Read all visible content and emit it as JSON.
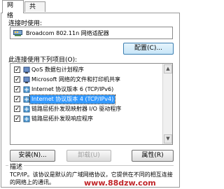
{
  "tabs": [
    {
      "label": "网络",
      "active": true
    },
    {
      "label": "共享",
      "active": false
    }
  ],
  "connect_using_label": "连接时使用:",
  "adapter_name": "Broadcom 802.11n 网络适配器",
  "configure_label": "配置(C)...",
  "items_label": "此连接使用下列项目(O):",
  "items": [
    {
      "label": "QoS 数据包计划程序",
      "checked": true,
      "icon": "service-icon",
      "selected": false
    },
    {
      "label": "Microsoft 网络的文件和打印机共享",
      "checked": true,
      "icon": "service-icon",
      "selected": false
    },
    {
      "label": "Internet 协议版本 6 (TCP/IPv6)",
      "checked": true,
      "icon": "protocol-icon",
      "selected": false
    },
    {
      "label": "Internet 协议版本 4 (TCP/IPv4)",
      "checked": true,
      "icon": "protocol-icon",
      "selected": true
    },
    {
      "label": "链路层拓扑发现映射器 I/O 驱动程序",
      "checked": true,
      "icon": "protocol-icon",
      "selected": false
    },
    {
      "label": "链路层拓扑发现响应程序",
      "checked": true,
      "icon": "protocol-icon",
      "selected": false
    }
  ],
  "buttons": {
    "install": "安装(N)...",
    "uninstall": "卸载(U)",
    "properties": "属性(R)"
  },
  "description_title": "描述",
  "description_text": "TCP/IP。该协议是默认的广域网络协议，它提供在不同的相互连接的网络上的通讯。",
  "watermark": "www.88dzw.com",
  "colors": {
    "selection": "#3399ff",
    "watermark": "#c0262a"
  }
}
